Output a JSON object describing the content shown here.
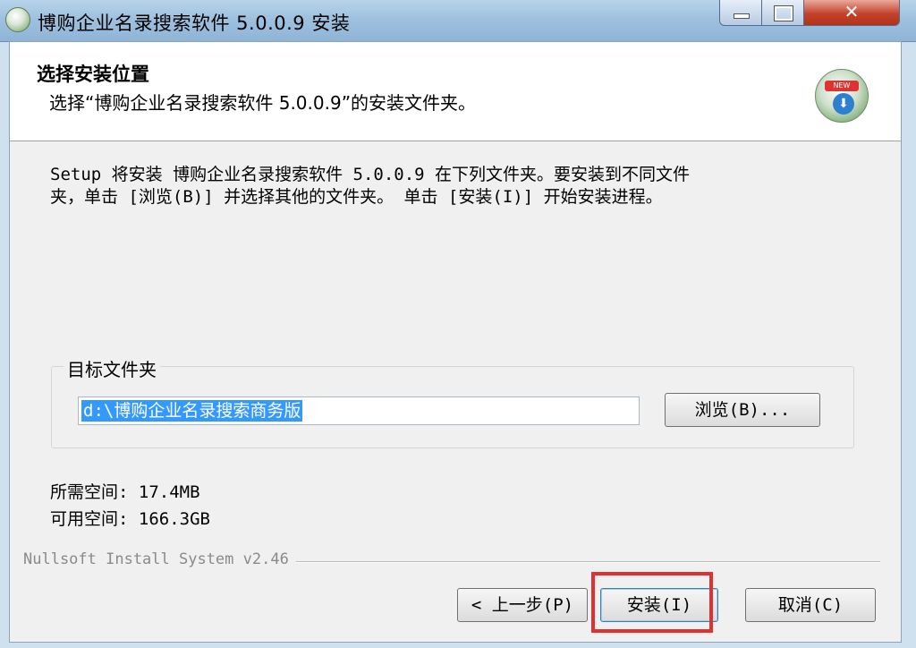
{
  "window": {
    "title": "博购企业名录搜索软件 5.0.0.9 安装",
    "close_glyph": "✕"
  },
  "header": {
    "title": "选择安装位置",
    "subtitle": "选择“博购企业名录搜索软件 5.0.0.9”的安装文件夹。",
    "logo_icon": "installer-logo-icon",
    "logo_badge": "NEW",
    "logo_arrow": "⬇"
  },
  "description": {
    "line1": "Setup 将安装 博购企业名录搜索软件 5.0.0.9 在下列文件夹。要安装到不同文件",
    "line2": "夹，单击 [浏览(B)] 并选择其他的文件夹。 单击 [安装(I)] 开始安装进程。"
  },
  "destination": {
    "group_label": "目标文件夹",
    "path_value": "d:\\博购企业名录搜索商务版",
    "browse_label": "浏览(B)..."
  },
  "space": {
    "required": "所需空间: 17.4MB",
    "available": "可用空间: 166.3GB"
  },
  "footer": {
    "branding": "Nullsoft Install System v2.46",
    "back_label": "< 上一步(P)",
    "install_label": "安装(I)",
    "cancel_label": "取消(C)"
  },
  "colors": {
    "highlight": "#e03030",
    "selection": "#3399ff"
  }
}
